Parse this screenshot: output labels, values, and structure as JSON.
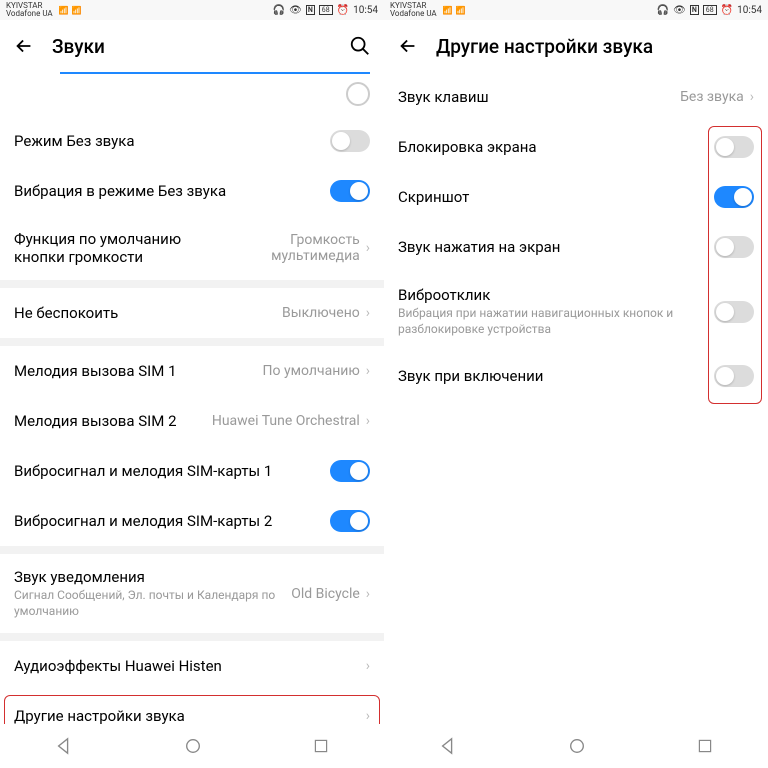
{
  "status": {
    "carrier1": "KYIVSTAR",
    "carrier2": "Vodafone UA",
    "battery": "68",
    "time": "10:54"
  },
  "left": {
    "title": "Звуки",
    "rows": {
      "silent": "Режим Без звука",
      "vibrate_silent": "Вибрация в режиме Без звука",
      "vol_btn_label": "Функция по умолчанию кнопки громкости",
      "vol_btn_value": "Громкость мультимедиа",
      "dnd_label": "Не беспокоить",
      "dnd_value": "Выключено",
      "sim1_label": "Мелодия вызова SIM 1",
      "sim1_value": "По умолчанию",
      "sim2_label": "Мелодия вызова SIM 2",
      "sim2_value": "Huawei Tune Orchestral",
      "vibring1": "Вибросигнал и мелодия SIM-карты 1",
      "vibring2": "Вибросигнал и мелодия SIM-карты 2",
      "notif_label": "Звук уведомления",
      "notif_sub": "Сигнал Сообщений, Эл. почты и Календаря по умолчанию",
      "notif_value": "Old Bicycle",
      "histen": "Аудиоэффекты Huawei Histen",
      "other": "Другие настройки звука"
    }
  },
  "right": {
    "title": "Другие настройки звука",
    "rows": {
      "dial_label": "Звук клавиш",
      "dial_value": "Без звука",
      "lock": "Блокировка экрана",
      "screenshot": "Скриншот",
      "touch": "Звук нажатия на экран",
      "haptic_label": "Виброотклик",
      "haptic_sub": "Вибрация при нажатии навигационных кнопок и разблокировке устройства",
      "startup": "Звук при включении"
    }
  }
}
